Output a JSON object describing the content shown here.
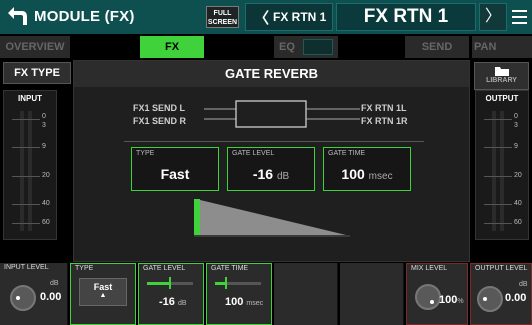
{
  "header": {
    "title": "MODULE (FX)",
    "fullscreen_label_1": "FULL",
    "fullscreen_label_2": "SCREEN",
    "prev_channel": "FX RTN 1",
    "current_channel": "FX RTN 1",
    "next_chevron": "〉",
    "prev_chevron": "〈"
  },
  "tabs": [
    {
      "label": "OVERVIEW",
      "active": false
    },
    {
      "label": "FX",
      "active": true
    },
    {
      "label": "EQ",
      "active": false
    },
    {
      "label": "SEND",
      "active": false
    },
    {
      "label": "PAN",
      "active": false
    }
  ],
  "side": {
    "fx_type_button": "FX TYPE",
    "library_button": "LIBRARY",
    "input_meter_title": "INPUT",
    "output_meter_title": "OUTPUT",
    "scale_ticks": [
      "0",
      "3",
      "9",
      "20",
      "40",
      "60"
    ]
  },
  "effect": {
    "name": "GATE REVERB",
    "send_l": "FX1 SEND L",
    "send_r": "FX1 SEND R",
    "rtn_l": "FX RTN 1L",
    "rtn_r": "FX RTN 1R",
    "params": [
      {
        "label": "TYPE",
        "value": "Fast",
        "unit": ""
      },
      {
        "label": "GATE LEVEL",
        "value": "-16",
        "unit": "dB"
      },
      {
        "label": "GATE TIME",
        "value": "100",
        "unit": "msec"
      }
    ]
  },
  "bottom": {
    "input_level": {
      "label": "INPUT LEVEL",
      "unit": "dB",
      "value": "0.00"
    },
    "type": {
      "label": "TYPE",
      "value": "Fast",
      "arrow": "▲"
    },
    "gate_level": {
      "label": "GATE LEVEL",
      "value": "-16",
      "unit": "dB"
    },
    "gate_time": {
      "label": "GATE TIME",
      "value": "100",
      "unit": "msec"
    },
    "mix_level": {
      "label": "MIX LEVEL",
      "value": "100",
      "unit": "%"
    },
    "output_level": {
      "label": "OUTPUT LEVEL",
      "unit": "dB",
      "value": "0.00"
    }
  },
  "colors": {
    "header_bg": "#0e4f50",
    "accent_green": "#3fd23a"
  }
}
